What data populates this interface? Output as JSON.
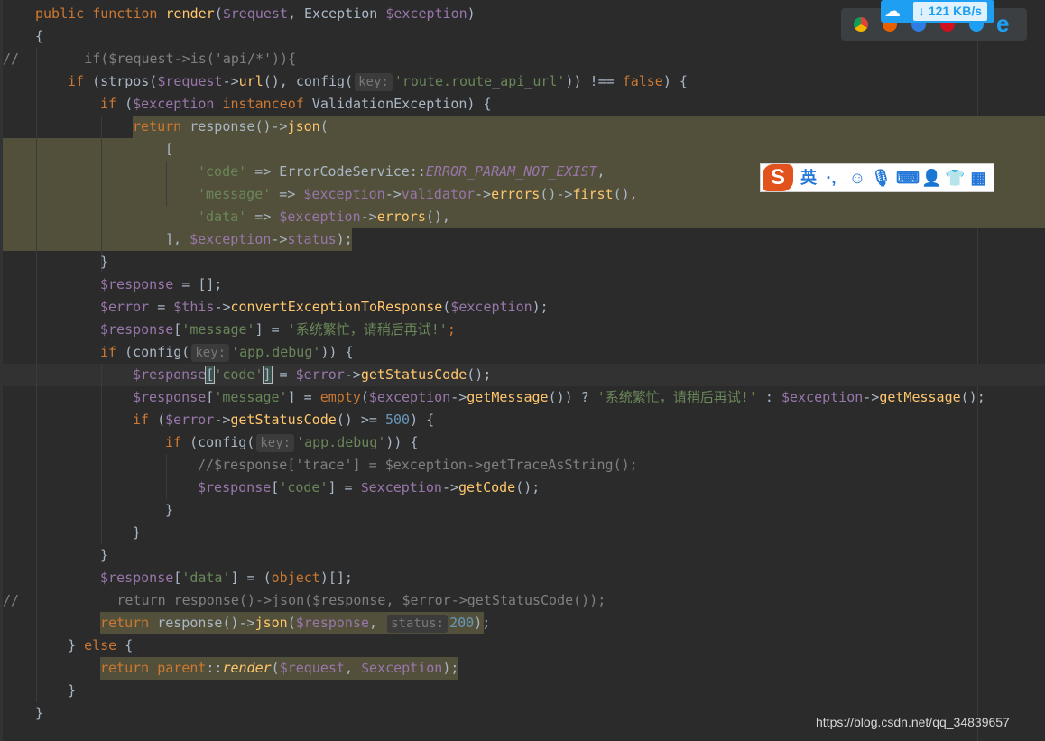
{
  "code": {
    "l0_a": "public function ",
    "l0_fn": "render",
    "l0_b": "(",
    "l0_v1": "$request",
    "l0_c": ", Exception ",
    "l0_v2": "$exception",
    "l0_d": ")",
    "l1": "{",
    "l2": "//        if($request->is('api/*')){",
    "l3_a": "if",
    "l3_b": " (strpos(",
    "l3_v": "$request",
    "l3_c": "->",
    "l3_fn": "url",
    "l3_d": "(), config(",
    "l3_hint": "key:",
    "l3_str": "'route.route_api_url'",
    "l3_e": ")) !== ",
    "l3_f": "false",
    "l3_g": ") {",
    "l4_a": "if",
    "l4_b": " (",
    "l4_v": "$exception",
    "l4_kw": " instanceof",
    "l4_c": " ValidationException) {",
    "l5_a": "return",
    "l5_b": " response()->",
    "l5_fn": "json",
    "l5_c": "(",
    "l6": "[",
    "l7_str": "'code'",
    "l7_b": " => ErrorCodeService::",
    "l7_const": "ERROR_PARAM_NOT_EXIST",
    "l7_c": ",",
    "l8_str": "'message'",
    "l8_b": " => ",
    "l8_v": "$exception",
    "l8_c": "->",
    "l8_fn1": "validator",
    "l8_d": "->",
    "l8_fn2": "errors",
    "l8_e": "()->",
    "l8_fn3": "first",
    "l8_f": "(),",
    "l9_str": "'data'",
    "l9_b": " => ",
    "l9_v": "$exception",
    "l9_c": "->",
    "l9_fn": "errors",
    "l9_d": "(),",
    "l10_a": "], ",
    "l10_v": "$exception",
    "l10_b": "->",
    "l10_fn": "status",
    "l10_c": ");",
    "l11": "}",
    "l12_v": "$response",
    "l12_b": " = [];",
    "l13_v1": "$error",
    "l13_b": " = ",
    "l13_v2": "$this",
    "l13_c": "->",
    "l13_fn": "convertExceptionToResponse",
    "l13_d": "(",
    "l13_v3": "$exception",
    "l13_e": ");",
    "l14_v": "$response",
    "l14_b": "[",
    "l14_str1": "'message'",
    "l14_c": "] = ",
    "l14_str2": "'系统繁忙，请稍后再试!'",
    "l14_d": ";",
    "l15_a": "if",
    "l15_b": " (config(",
    "l15_hint": "key:",
    "l15_str": "'app.debug'",
    "l15_c": ")) {",
    "l16_v1": "$response",
    "l16_b1": "[",
    "l16_str": "'code'",
    "l16_b2": "]",
    "l16_c": " = ",
    "l16_v2": "$error",
    "l16_d": "->",
    "l16_fn": "getStatusCode",
    "l16_e": "();",
    "l17_v1": "$response",
    "l17_b": "[",
    "l17_str1": "'message'",
    "l17_c": "] = ",
    "l17_fn1": "empty",
    "l17_d": "(",
    "l17_v2": "$exception",
    "l17_e": "->",
    "l17_fn2": "getMessage",
    "l17_f": "()) ? ",
    "l17_str2": "'系统繁忙，请稍后再试!'",
    "l17_g": " : ",
    "l17_v3": "$exception",
    "l17_h": "->",
    "l17_fn3": "getMessage",
    "l17_i": "();",
    "l18_a": "if",
    "l18_b": " (",
    "l18_v": "$error",
    "l18_c": "->",
    "l18_fn": "getStatusCode",
    "l18_d": "() >= ",
    "l18_num": "500",
    "l18_e": ") {",
    "l19_a": "if",
    "l19_b": " (config(",
    "l19_hint": "key:",
    "l19_str": "'app.debug'",
    "l19_c": ")) {",
    "l20": "//$response['trace'] = $exception->getTraceAsString();",
    "l21_v1": "$response",
    "l21_b": "[",
    "l21_str": "'code'",
    "l21_c": "] = ",
    "l21_v2": "$exception",
    "l21_d": "->",
    "l21_fn": "getCode",
    "l21_e": "();",
    "l22": "}",
    "l23": "}",
    "l24": "}",
    "l25_v": "$response",
    "l25_b": "[",
    "l25_str": "'data'",
    "l25_c": "] = (",
    "l25_kw": "object",
    "l25_d": ")[];",
    "l26": "//            return response()->json($response, $error->getStatusCode());",
    "l27_a": "return",
    "l27_b": " response()->",
    "l27_fn": "json",
    "l27_c": "(",
    "l27_v": "$response",
    "l27_d": ", ",
    "l27_hint": "status:",
    "l27_num": "200",
    "l27_e": ");",
    "l28_a": "} ",
    "l28_kw": "else",
    "l28_b": " {",
    "l29_a": "return",
    "l29_kw": " parent",
    "l29_b": "::",
    "l29_fn": "render",
    "l29_c": "(",
    "l29_v1": "$request",
    "l29_d": ", ",
    "l29_v2": "$exception",
    "l29_e": ");",
    "l30": "}",
    "l31": "}"
  },
  "overlays": {
    "download_rate": "121 KB/s",
    "ime_s": "S",
    "ime_lang": "英",
    "watermark": "https://blog.csdn.net/qq_34839657"
  },
  "colors": {
    "background": "#2b2b2b",
    "keyword": "#cc7832",
    "variable": "#9876aa",
    "function": "#ffc66d",
    "string": "#6a8759",
    "number": "#6897bb",
    "comment": "#808080",
    "highlight": "#52503a"
  }
}
